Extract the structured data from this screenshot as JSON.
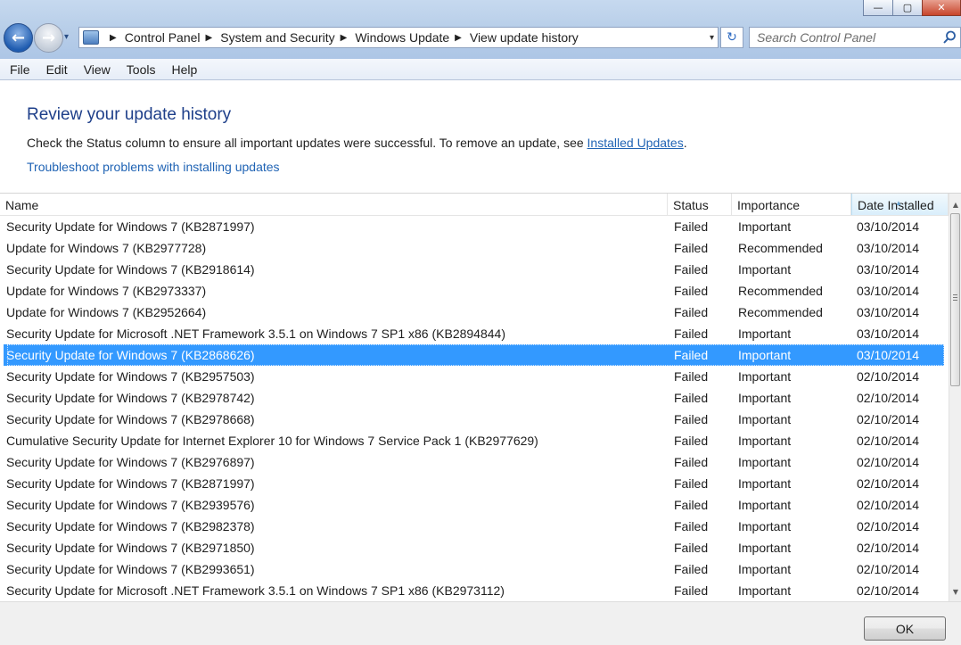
{
  "window": {
    "minimize_glyph": "—",
    "maximize_glyph": "▢",
    "close_glyph": "✕"
  },
  "nav": {
    "back_glyph": "←",
    "forward_glyph": "→",
    "history_glyph": "▾",
    "breadcrumb_sep": "▶",
    "breadcrumbs": [
      "Control Panel",
      "System and Security",
      "Windows Update",
      "View update history"
    ],
    "address_dropdown_glyph": "▾",
    "refresh_glyph": "↻"
  },
  "search": {
    "placeholder": "Search Control Panel"
  },
  "menu": {
    "items": [
      "File",
      "Edit",
      "View",
      "Tools",
      "Help"
    ]
  },
  "header": {
    "title": "Review your update history",
    "description_prefix": "Check the Status column to ensure all important updates were successful. To remove an update, see ",
    "description_link": "Installed Updates",
    "description_suffix": ".",
    "troubleshoot_link": "Troubleshoot problems with installing updates"
  },
  "table": {
    "columns": {
      "name": "Name",
      "status": "Status",
      "importance": "Importance",
      "date": "Date Installed"
    },
    "selected_row": 6,
    "rows": [
      {
        "name": "Security Update for Windows 7 (KB2871997)",
        "status": "Failed",
        "importance": "Important",
        "date": "03/10/2014"
      },
      {
        "name": "Update for Windows 7 (KB2977728)",
        "status": "Failed",
        "importance": "Recommended",
        "date": "03/10/2014"
      },
      {
        "name": "Security Update for Windows 7 (KB2918614)",
        "status": "Failed",
        "importance": "Important",
        "date": "03/10/2014"
      },
      {
        "name": "Update for Windows 7 (KB2973337)",
        "status": "Failed",
        "importance": "Recommended",
        "date": "03/10/2014"
      },
      {
        "name": "Update for Windows 7 (KB2952664)",
        "status": "Failed",
        "importance": "Recommended",
        "date": "03/10/2014"
      },
      {
        "name": "Security Update for Microsoft .NET Framework 3.5.1 on Windows 7 SP1 x86 (KB2894844)",
        "status": "Failed",
        "importance": "Important",
        "date": "03/10/2014"
      },
      {
        "name": "Security Update for Windows 7 (KB2868626)",
        "status": "Failed",
        "importance": "Important",
        "date": "03/10/2014"
      },
      {
        "name": "Security Update for Windows 7 (KB2957503)",
        "status": "Failed",
        "importance": "Important",
        "date": "02/10/2014"
      },
      {
        "name": "Security Update for Windows 7 (KB2978742)",
        "status": "Failed",
        "importance": "Important",
        "date": "02/10/2014"
      },
      {
        "name": "Security Update for Windows 7 (KB2978668)",
        "status": "Failed",
        "importance": "Important",
        "date": "02/10/2014"
      },
      {
        "name": "Cumulative Security Update for Internet Explorer 10 for Windows 7 Service Pack 1 (KB2977629)",
        "status": "Failed",
        "importance": "Important",
        "date": "02/10/2014"
      },
      {
        "name": "Security Update for Windows 7 (KB2976897)",
        "status": "Failed",
        "importance": "Important",
        "date": "02/10/2014"
      },
      {
        "name": "Security Update for Windows 7 (KB2871997)",
        "status": "Failed",
        "importance": "Important",
        "date": "02/10/2014"
      },
      {
        "name": "Security Update for Windows 7 (KB2939576)",
        "status": "Failed",
        "importance": "Important",
        "date": "02/10/2014"
      },
      {
        "name": "Security Update for Windows 7 (KB2982378)",
        "status": "Failed",
        "importance": "Important",
        "date": "02/10/2014"
      },
      {
        "name": "Security Update for Windows 7 (KB2971850)",
        "status": "Failed",
        "importance": "Important",
        "date": "02/10/2014"
      },
      {
        "name": "Security Update for Windows 7 (KB2993651)",
        "status": "Failed",
        "importance": "Important",
        "date": "02/10/2014"
      },
      {
        "name": "Security Update for Microsoft .NET Framework 3.5.1 on Windows 7 SP1 x86 (KB2973112)",
        "status": "Failed",
        "importance": "Important",
        "date": "02/10/2014"
      }
    ]
  },
  "scrollbar": {
    "up_glyph": "▲",
    "down_glyph": "▼"
  },
  "footer": {
    "ok_label": "OK"
  },
  "colors": {
    "selection": "#3399ff",
    "link": "#1f63b4",
    "heading": "#1e3f8a"
  }
}
